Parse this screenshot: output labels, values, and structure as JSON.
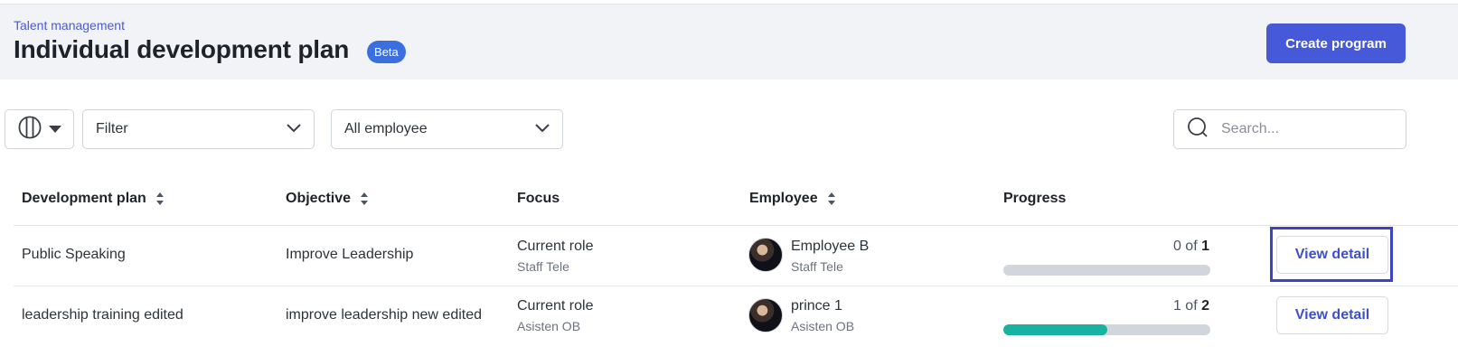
{
  "header": {
    "breadcrumb": "Talent management",
    "title": "Individual development plan",
    "badge": "Beta",
    "create_button": "Create program"
  },
  "toolbar": {
    "column_toggle_icon": "columns-icon",
    "filter_value": "Filter",
    "employee_filter_value": "All employee",
    "search_placeholder": "Search..."
  },
  "table": {
    "columns": [
      {
        "label": "Development plan",
        "sortable": true
      },
      {
        "label": "Objective",
        "sortable": true
      },
      {
        "label": "Focus",
        "sortable": false
      },
      {
        "label": "Employee",
        "sortable": true
      },
      {
        "label": "Progress",
        "sortable": false
      }
    ],
    "rows": [
      {
        "plan": "Public Speaking",
        "objective": "Improve Leadership",
        "focus": "Current role",
        "focus_sub": "Staff Tele",
        "employee": "Employee B",
        "employee_sub": "Staff Tele",
        "progress_done": "0",
        "progress_of": "of",
        "progress_total": "1",
        "progress_fraction": 0,
        "action": "View detail"
      },
      {
        "plan": "leadership training edited",
        "objective": "improve leadership new edited",
        "focus": "Current role",
        "focus_sub": "Asisten OB",
        "employee": "prince 1",
        "employee_sub": "Asisten OB",
        "progress_done": "1",
        "progress_of": "of",
        "progress_total": "2",
        "progress_fraction": 0.5,
        "action": "View detail"
      }
    ]
  },
  "colors": {
    "accent": "#4659d8",
    "progress_fill": "#17b3a0",
    "badge": "#3b6fe0"
  }
}
